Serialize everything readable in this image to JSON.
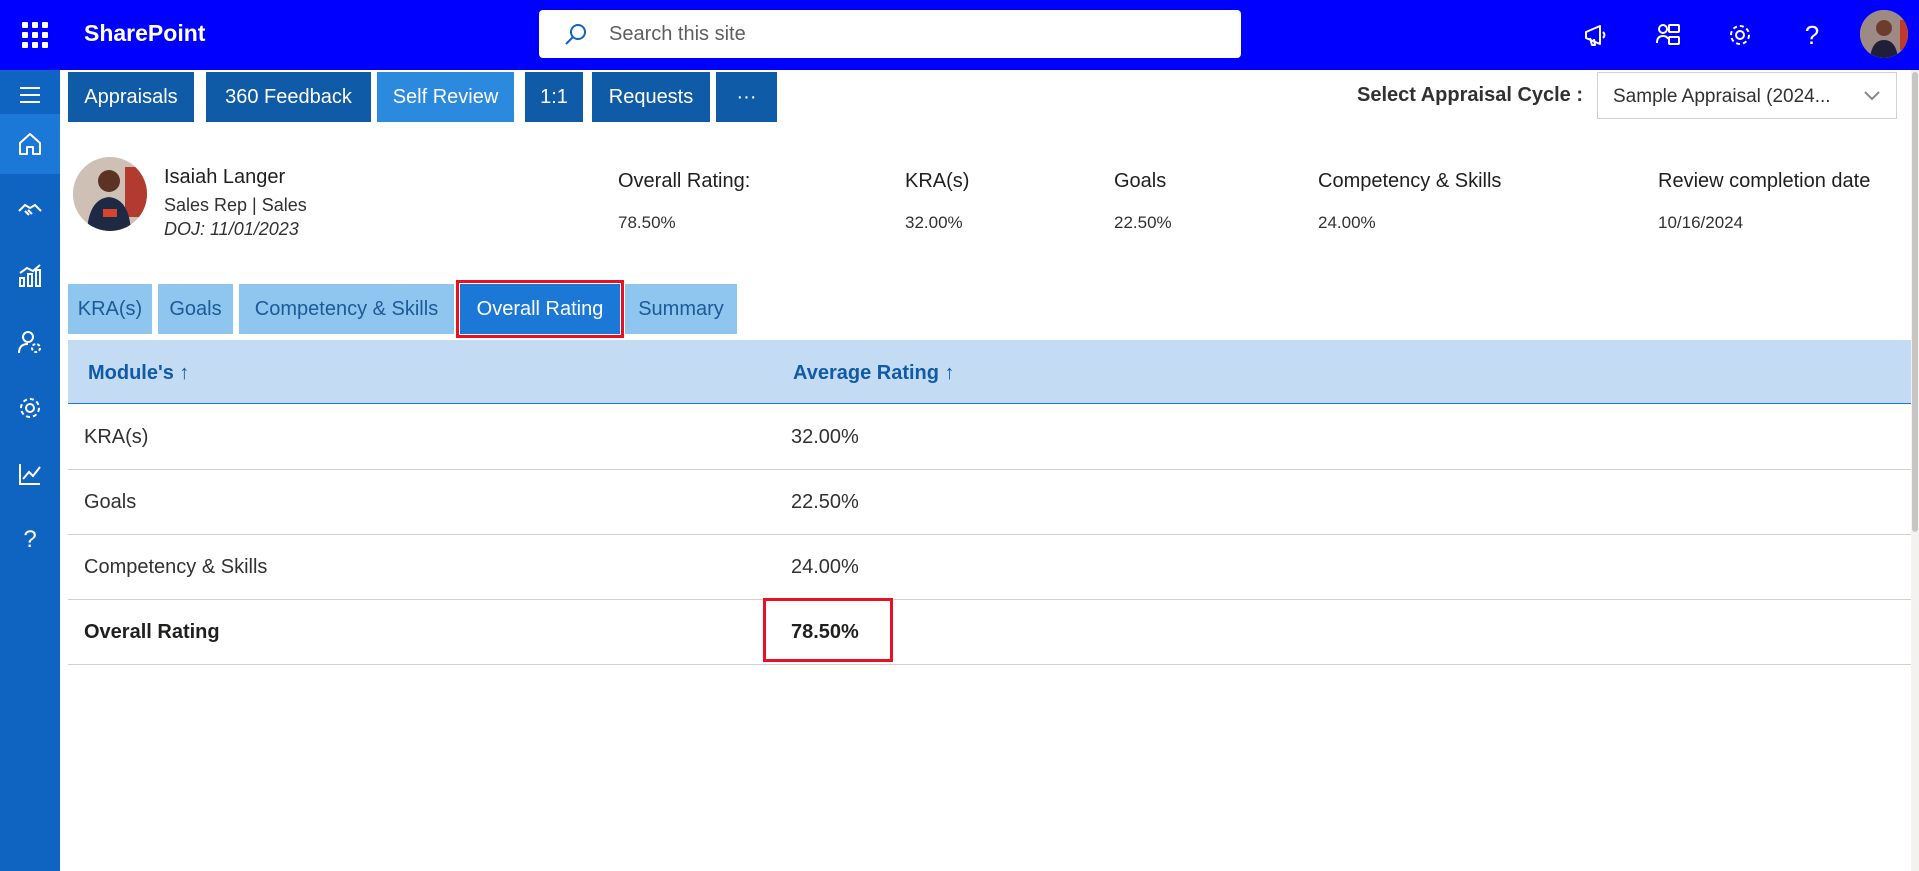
{
  "suite": {
    "app_name": "SharePoint",
    "search_placeholder": "Search this site"
  },
  "icons": {
    "waffle": "app-launcher-icon",
    "search": "search-icon",
    "announce": "megaphone-icon",
    "settings": "gear-icon",
    "help": "help-icon"
  },
  "top_nav": {
    "tabs": [
      {
        "label": "Appraisals"
      },
      {
        "label": "360 Feedback"
      },
      {
        "label": "Self Review"
      },
      {
        "label": "1:1"
      },
      {
        "label": "Requests"
      },
      {
        "label": "···"
      }
    ],
    "active": "Self Review"
  },
  "cycle": {
    "label": "Select Appraisal Cycle :",
    "value": "Sample Appraisal (2024..."
  },
  "profile": {
    "name": "Isaiah Langer",
    "role": "Sales Rep | Sales",
    "doj": "DOJ: 11/01/2023"
  },
  "stats": [
    {
      "label": "Overall Rating:",
      "value": "78.50%"
    },
    {
      "label": "KRA(s)",
      "value": "32.00%"
    },
    {
      "label": "Goals",
      "value": "22.50%"
    },
    {
      "label": "Competency & Skills",
      "value": "24.00%"
    },
    {
      "label": "Review completion date",
      "value": "10/16/2024"
    }
  ],
  "sub_tabs": [
    {
      "label": "KRA(s)"
    },
    {
      "label": "Goals"
    },
    {
      "label": "Competency & Skills"
    },
    {
      "label": "Overall Rating"
    },
    {
      "label": "Summary"
    }
  ],
  "active_sub_tab": "Overall Rating",
  "table": {
    "columns": [
      "Module's ↑",
      "Average Rating ↑"
    ],
    "rows": [
      [
        "KRA(s)",
        "32.00%"
      ],
      [
        "Goals",
        "22.50%"
      ],
      [
        "Competency & Skills",
        "24.00%"
      ],
      [
        "Overall Rating",
        "78.50%"
      ]
    ]
  },
  "colors": {
    "suitebar": "#0000ff",
    "rail": "#0f64c1",
    "highlight": "#e81123"
  }
}
